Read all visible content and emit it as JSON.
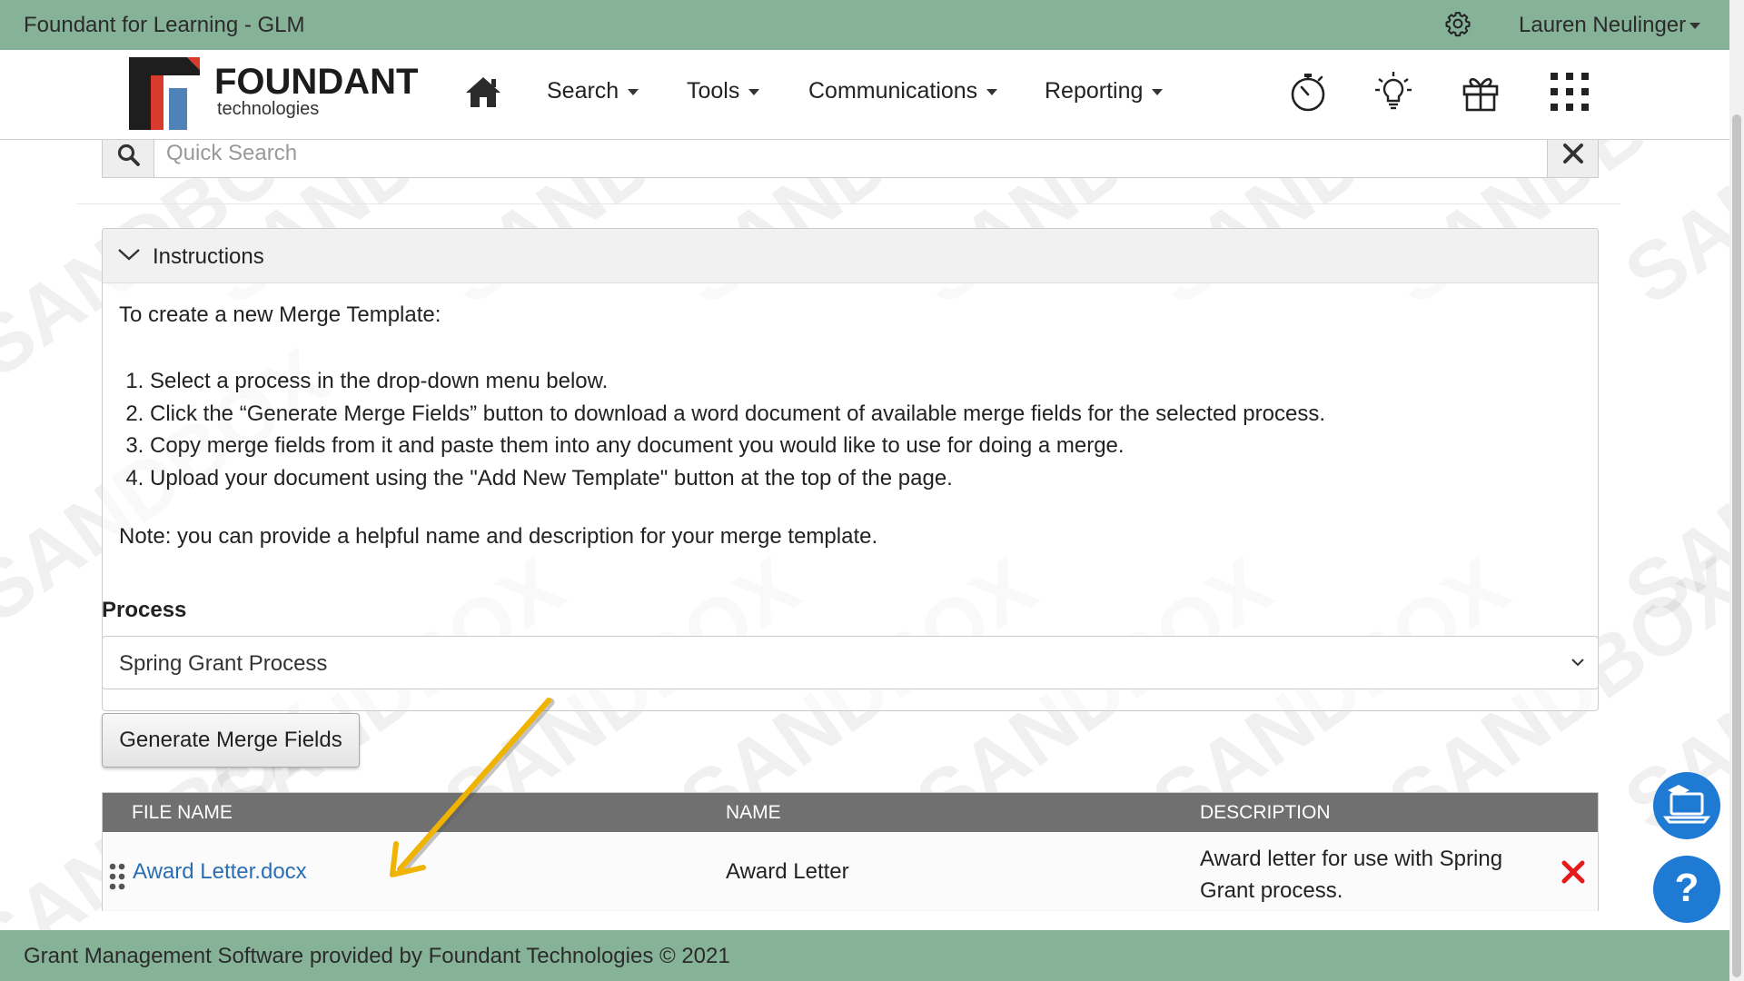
{
  "topbar": {
    "app_title": "Foundant for Learning - GLM",
    "user_name": "Lauren Neulinger"
  },
  "logo": {
    "brand": "FOUNDANT",
    "sub": "technologies"
  },
  "nav": {
    "items": [
      {
        "label": "Search"
      },
      {
        "label": "Tools"
      },
      {
        "label": "Communications"
      },
      {
        "label": "Reporting"
      }
    ]
  },
  "quick_search": {
    "placeholder": "Quick Search"
  },
  "watermark_text": "SANDBOX",
  "instructions": {
    "title": "Instructions",
    "intro": "To create a new Merge Template:",
    "steps": [
      "Select a process in the drop-down menu below.",
      "Click the “Generate Merge Fields” button to download a word document of available merge fields for the selected process.",
      "Copy merge fields from it and paste them into any document you would like to use for doing a merge.",
      "Upload your document using the \"Add New Template\" button at the top of the page."
    ],
    "note": "Note: you can provide a helpful name and description for your merge template."
  },
  "process": {
    "label": "Process",
    "selected": "Spring Grant Process"
  },
  "generate_button": "Generate Merge Fields",
  "table": {
    "headers": [
      "FILE NAME",
      "NAME",
      "DESCRIPTION"
    ],
    "rows": [
      {
        "file_name": "Award Letter.docx",
        "name": "Award Letter",
        "description": "Award letter for use with Spring Grant process."
      }
    ]
  },
  "footer": {
    "text": "Grant Management Software provided by Foundant Technologies © 2021"
  },
  "colors": {
    "topbar": "#86b398",
    "table_header": "#707070",
    "link": "#2a6fb5",
    "delete": "#e31b1b",
    "float_button": "#1f7ad4",
    "annotation_arrow": "#f0b400"
  }
}
